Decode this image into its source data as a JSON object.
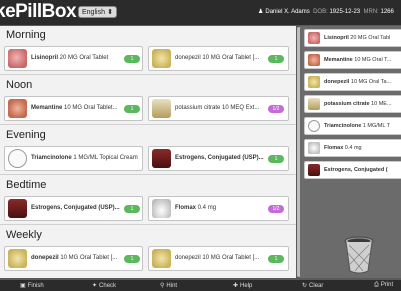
{
  "app": {
    "brand": "kePillBox",
    "language": "English"
  },
  "patient": {
    "icon": "user-icon",
    "name": "Daniel X. Adams",
    "dob_label": "DOB:",
    "dob": "1925-12-23",
    "mrn_label": "MRN:",
    "mrn": "1266"
  },
  "sections": {
    "morning": {
      "title": "Morning",
      "slot1": {
        "name_bold": "Lisinopril",
        "name_rest": " 20 MG Oral Tablet",
        "badge": "1"
      },
      "slot2": {
        "name_bold": "",
        "name_rest": "donepezil 10 MG Oral Tablet [...",
        "badge": "1"
      }
    },
    "noon": {
      "title": "Noon",
      "slot1": {
        "name_bold": "Memantine",
        "name_rest": " 10 MG Oral Tablet...",
        "badge": "1"
      },
      "slot2": {
        "name_bold": "",
        "name_rest": "potassium citrate 10 MEQ Ext...",
        "badge": "1/2"
      }
    },
    "evening": {
      "title": "Evening",
      "slot1": {
        "name_bold": "Triamcinolone",
        "name_rest": " 1 MG/ML Topical Cream",
        "badge": "1"
      },
      "slot2": {
        "name_bold": "Estrogens, Conjugated (USP)...",
        "name_rest": "",
        "badge": "1"
      }
    },
    "bedtime": {
      "title": "Bedtime",
      "slot1": {
        "name_bold": "Estrogens, Conjugated (USP)...",
        "name_rest": "",
        "badge": "1"
      },
      "slot2": {
        "name_bold": "Flomax",
        "name_rest": " 0.4 mg",
        "badge": "1/2"
      }
    },
    "weekly": {
      "title": "Weekly",
      "slot1": {
        "name_bold": "donepezil",
        "name_rest": " 10 MG Oral Tablet [...",
        "badge": "1"
      },
      "slot2": {
        "name_bold": "",
        "name_rest": "donepezil 10 MG Oral Tablet [...",
        "badge": "1"
      }
    }
  },
  "med_list": [
    {
      "bold": "Lisinopril",
      "rest": " 20 MG Oral Tabl"
    },
    {
      "bold": "Memantine",
      "rest": " 10 MG Oral T..."
    },
    {
      "bold": "donepezil",
      "rest": " 10 MG Oral Ta..."
    },
    {
      "bold": "potassium citrate",
      "rest": " 10 ME..."
    },
    {
      "bold": "Triamcinolone",
      "rest": " 1 MG/ML T"
    },
    {
      "bold": "Flomax",
      "rest": " 0.4 mg"
    },
    {
      "bold": "Estrogens, Conjugated (",
      "rest": ""
    }
  ],
  "toolbar": {
    "finish": "Finish",
    "check": "Check",
    "hint": "Hint",
    "help": "Help",
    "clear": "Clear",
    "print": "Print"
  },
  "colors": {
    "badge_green": "#5cb85c",
    "badge_purple": "#c46ad9"
  }
}
